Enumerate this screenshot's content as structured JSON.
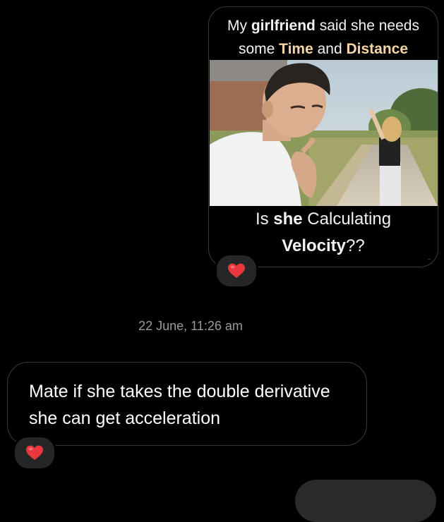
{
  "meme": {
    "top_line1_pre": "My ",
    "top_line1_bold": "girlfriend",
    "top_line1_post": " said she needs",
    "top_line2_pre": "some ",
    "top_line2_hl1": "Time",
    "top_line2_mid": " and ",
    "top_line2_hl2": "Distance",
    "bottom_line1_pre": "Is ",
    "bottom_line1_bold": "she",
    "bottom_line1_post": " Calculating",
    "bottom_line2_bold": "Velocity",
    "bottom_line2_post": "??"
  },
  "reactions": {
    "meme_reaction": "heart-icon",
    "reply_reaction": "heart-icon",
    "heart_color": "#e8373d"
  },
  "timestamp": "22 June, 11:26 am",
  "reply": {
    "text": "Mate if she takes the double derivative she can get acceleration"
  },
  "colors": {
    "background": "#000000",
    "border": "#3a3a3a",
    "highlight": "#f4d6a4",
    "timestamp": "#9a9a9a"
  }
}
